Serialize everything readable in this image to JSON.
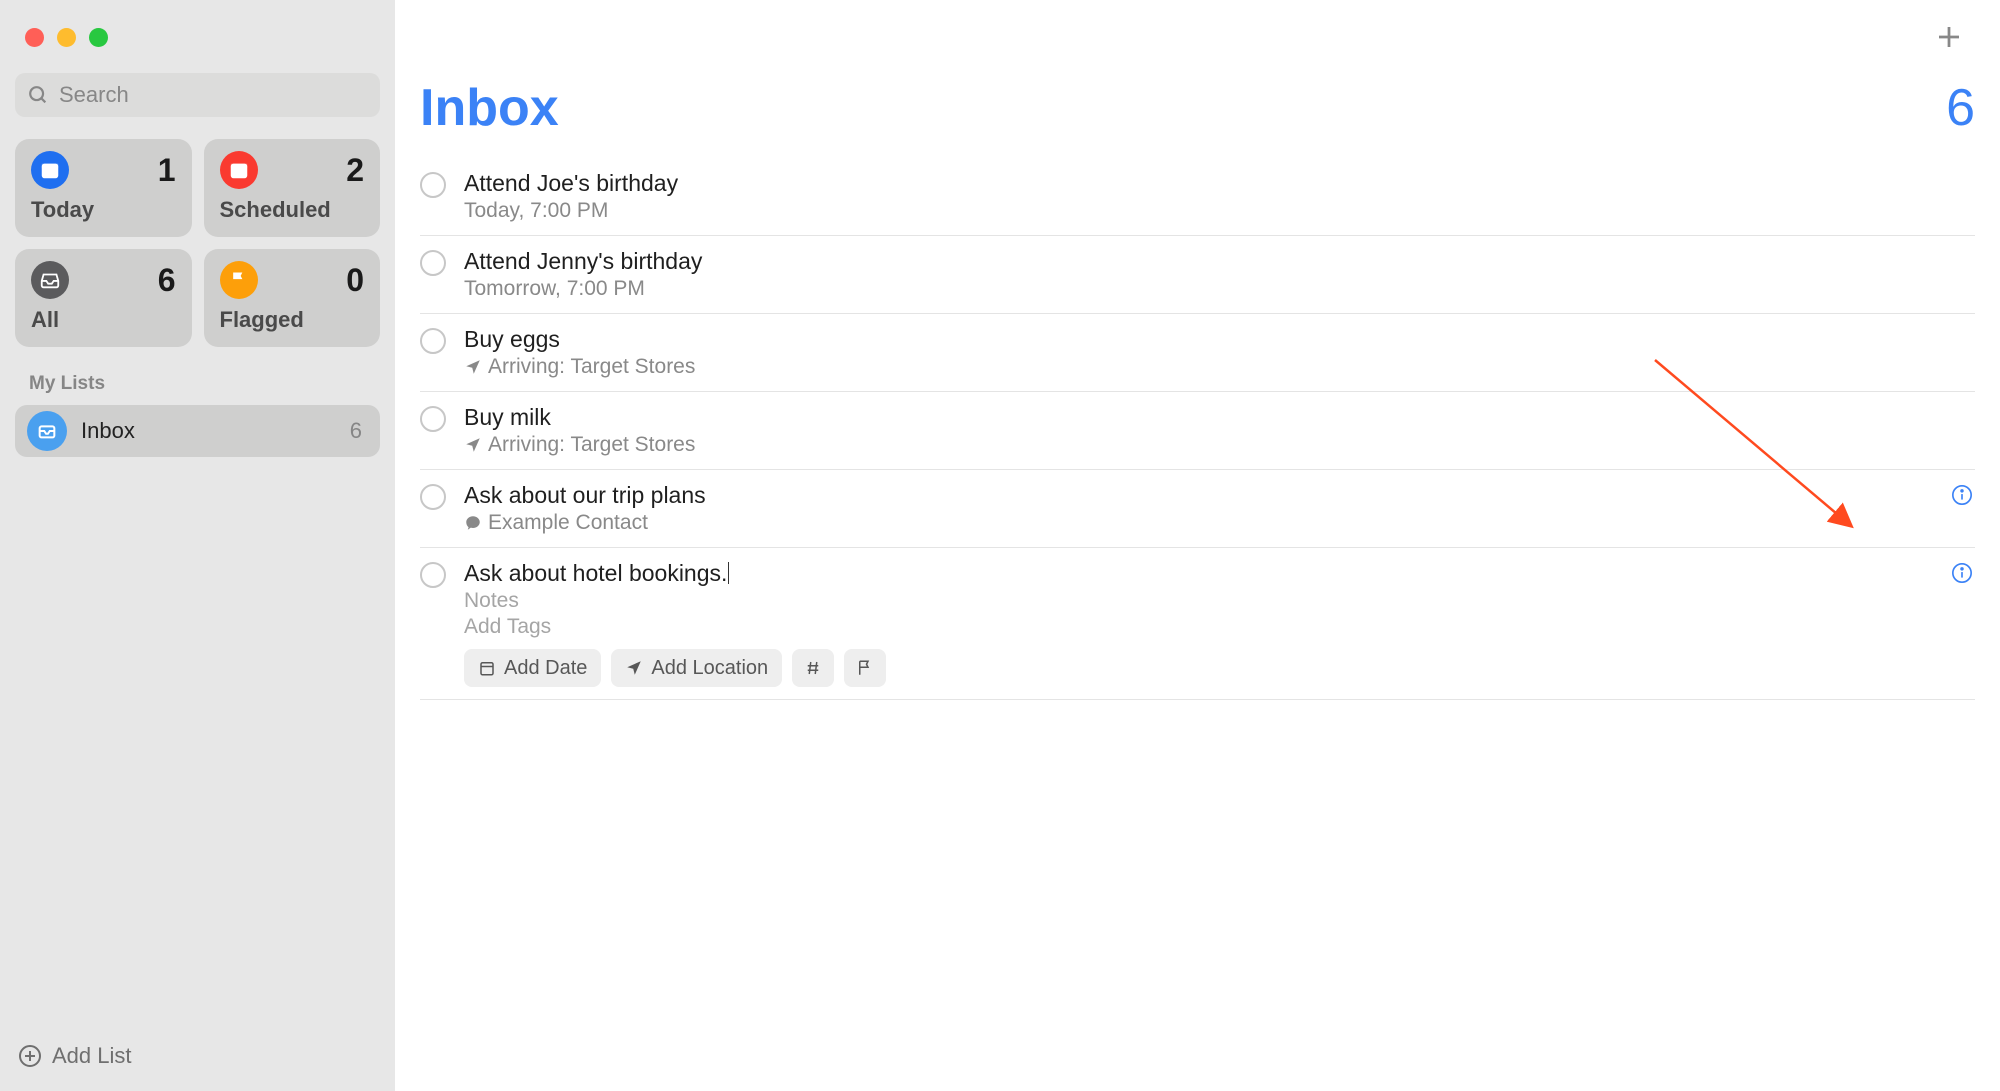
{
  "sidebar": {
    "search_placeholder": "Search",
    "smart": [
      {
        "label": "Today",
        "count": "1",
        "color": "#1f6ff0",
        "icon": "calendar"
      },
      {
        "label": "Scheduled",
        "count": "2",
        "color": "#fa3a30",
        "icon": "calendar"
      },
      {
        "label": "All",
        "count": "6",
        "color": "#5b5b5d",
        "icon": "tray"
      },
      {
        "label": "Flagged",
        "count": "0",
        "color": "#fd9f0a",
        "icon": "flag"
      }
    ],
    "lists_header": "My Lists",
    "lists": [
      {
        "name": "Inbox",
        "count": "6",
        "color": "#4aa0ef"
      }
    ],
    "add_list_label": "Add List"
  },
  "header": {
    "title": "Inbox",
    "count": "6"
  },
  "reminders": [
    {
      "title": "Attend Joe's birthday",
      "subtitle": "Today, 7:00 PM",
      "sub_icon": null,
      "info": false
    },
    {
      "title": "Attend Jenny's birthday",
      "subtitle": "Tomorrow, 7:00 PM",
      "sub_icon": null,
      "info": false
    },
    {
      "title": "Buy eggs",
      "subtitle": "Arriving: Target Stores",
      "sub_icon": "location",
      "info": false
    },
    {
      "title": "Buy milk",
      "subtitle": "Arriving: Target Stores",
      "sub_icon": "location",
      "info": false
    },
    {
      "title": "Ask about our trip plans",
      "subtitle": "Example Contact",
      "sub_icon": "message",
      "info": true
    }
  ],
  "editing": {
    "title": "Ask about hotel bookings.",
    "notes_placeholder": "Notes",
    "tags_placeholder": "Add Tags",
    "chips": {
      "add_date": "Add Date",
      "add_location": "Add Location"
    }
  },
  "colors": {
    "accent": "#3b82f6"
  }
}
